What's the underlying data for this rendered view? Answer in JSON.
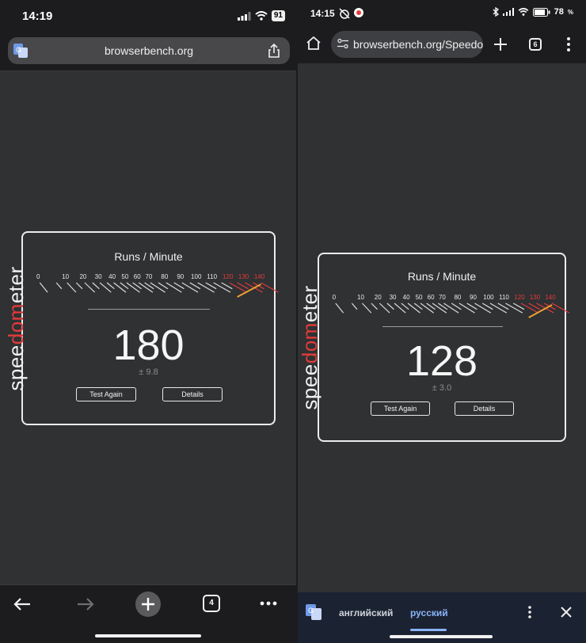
{
  "left": {
    "status": {
      "time": "14:19",
      "battery": "91"
    },
    "url": "browserbench.org",
    "tab_count": "4",
    "icons": [
      "translate-icon",
      "share-icon",
      "back-icon",
      "forward-icon",
      "new-tab-icon",
      "tabs-icon",
      "more-icon"
    ]
  },
  "right": {
    "status": {
      "time": "14:15",
      "battery": "78"
    },
    "url": "browserbench.org/Speedometer",
    "tab_count": "6",
    "translate_bar": {
      "source_lang": "английский",
      "target_lang": "русский"
    }
  },
  "speedometer": {
    "title": "Runs / Minute",
    "logo": {
      "prefix": "spee",
      "accent": "dom",
      "suffix": "eter"
    },
    "ticks": [
      "0",
      "10",
      "20",
      "30",
      "40",
      "50",
      "60",
      "70",
      "80",
      "90",
      "100",
      "110",
      "120",
      "130",
      "140"
    ],
    "red_ticks_from": "120",
    "test_again": "Test Again",
    "details": "Details"
  },
  "results": {
    "left": {
      "score": "180",
      "error": "± 9.8"
    },
    "right": {
      "score": "128",
      "error": "± 3.0"
    }
  },
  "colors": {
    "accent_red": "#e23b3b",
    "needle_orange": "#f0a030",
    "translate_blue": "#8ab4f8"
  }
}
